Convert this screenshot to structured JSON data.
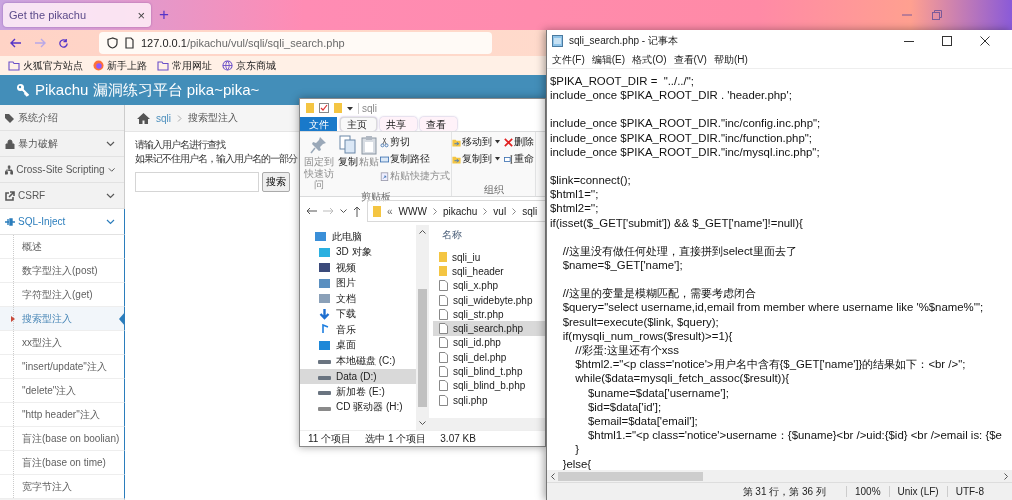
{
  "browser": {
    "tab": {
      "title": "Get the pikachu",
      "close": "×"
    },
    "new_tab": "+",
    "back": {
      "disabled": false
    },
    "forward": {
      "disabled": true
    },
    "url": {
      "host": "127.0.0.1",
      "path": "/pikachu/vul/sqli/sqli_search.php"
    },
    "bookmarks": [
      {
        "label": "火狐官方站点",
        "kind": "folder"
      },
      {
        "label": "新手上路",
        "kind": "firefox"
      },
      {
        "label": "常用网址",
        "kind": "folder"
      },
      {
        "label": "京东商城",
        "kind": "globe"
      }
    ]
  },
  "page": {
    "header": "Pikachu 漏洞练习平台 pika~pika~",
    "sidebar": [
      {
        "label": "系统介绍",
        "kind": "tag"
      },
      {
        "label": "暴力破解",
        "kind": "lock",
        "expanded": false
      },
      {
        "label": "Cross-Site Scripting",
        "kind": "sitemap",
        "expanded": false
      },
      {
        "label": "CSRF",
        "kind": "share",
        "expanded": false
      },
      {
        "label": "SQL-Inject",
        "kind": "plug",
        "expanded": true,
        "children": [
          {
            "label": "概述",
            "selected": false
          },
          {
            "label": "数字型注入(post)",
            "selected": false
          },
          {
            "label": "字符型注入(get)",
            "selected": false
          },
          {
            "label": "搜索型注入",
            "selected": true
          },
          {
            "label": "xx型注入",
            "selected": false
          },
          {
            "label": "\"insert/update\"注入",
            "selected": false
          },
          {
            "label": "\"delete\"注入",
            "selected": false
          },
          {
            "label": "\"http header\"注入",
            "selected": false
          },
          {
            "label": "盲注(base on boolian)",
            "selected": false
          },
          {
            "label": "盲注(base on time)",
            "selected": false
          },
          {
            "label": "宽字节注入",
            "selected": false
          }
        ]
      }
    ],
    "breadcrumb": {
      "link": "sqli",
      "current": "搜索型注入"
    },
    "prompt": [
      "请输入用户名进行查找",
      "如果记不住用户名，输入用户名的一部分"
    ],
    "search_button": "搜索"
  },
  "explorer": {
    "title": "sqli",
    "ribbon_tabs": [
      {
        "label": "文件",
        "kind": "file",
        "selected": false
      },
      {
        "label": "主页",
        "kind": "tab",
        "selected": true
      },
      {
        "label": "共享",
        "kind": "tab",
        "selected": false
      },
      {
        "label": "查看",
        "kind": "tab",
        "selected": false
      }
    ],
    "ribbon_groups": [
      {
        "label": "剪贴板",
        "large": [
          {
            "lines": [
              "固定到",
              "快速访问"
            ],
            "kind": "pin",
            "disabled": true
          },
          {
            "label": "复制",
            "kind": "copy",
            "disabled": false
          },
          {
            "label": "粘贴",
            "kind": "paste",
            "disabled": true
          }
        ],
        "columns": [
          [
            {
              "label": "剪切",
              "kind": "cut",
              "disabled": false
            },
            {
              "label": "复制路径",
              "kind": "copy-path",
              "disabled": false
            },
            {
              "label": "粘贴快捷方式",
              "kind": "paste-shortcut",
              "disabled": true
            }
          ]
        ]
      },
      {
        "label": "组织",
        "columns": [
          [
            {
              "label": "移动到",
              "kind": "move",
              "disabled": false,
              "dropdown": true
            },
            {
              "label": "复制到",
              "kind": "copy-to",
              "disabled": false,
              "dropdown": true
            }
          ],
          [
            {
              "label": "删除",
              "kind": "delete",
              "disabled": false
            },
            {
              "label": "重命",
              "kind": "rename",
              "disabled": false
            }
          ]
        ]
      }
    ],
    "address_prefix": "«",
    "address": [
      "WWW",
      "pikachu",
      "vul",
      "sqli"
    ],
    "nav_pane": [
      {
        "label": "此电脑",
        "kind": "pc",
        "selected": false
      },
      {
        "label": "3D 对象",
        "kind": "objects",
        "selected": false
      },
      {
        "label": "视频",
        "kind": "video",
        "selected": false
      },
      {
        "label": "图片",
        "kind": "pictures",
        "selected": false
      },
      {
        "label": "文档",
        "kind": "documents",
        "selected": false
      },
      {
        "label": "下载",
        "kind": "downloads",
        "selected": false
      },
      {
        "label": "音乐",
        "kind": "music",
        "selected": false
      },
      {
        "label": "桌面",
        "kind": "desktop",
        "selected": false
      },
      {
        "label": "本地磁盘 (C:)",
        "kind": "drive",
        "selected": false
      },
      {
        "label": "Data (D:)",
        "kind": "drive",
        "selected": true
      },
      {
        "label": "新加卷 (E:)",
        "kind": "drive",
        "selected": false
      },
      {
        "label": "CD 驱动器 (H:)",
        "kind": "cd",
        "selected": false
      }
    ],
    "column": "名称",
    "files": [
      {
        "name": "sqli_iu",
        "kind": "folder",
        "selected": false
      },
      {
        "name": "sqli_header",
        "kind": "folder",
        "selected": false
      },
      {
        "name": "sqli_x.php",
        "kind": "file",
        "selected": false
      },
      {
        "name": "sqli_widebyte.php",
        "kind": "file",
        "selected": false
      },
      {
        "name": "sqli_str.php",
        "kind": "file",
        "selected": false
      },
      {
        "name": "sqli_search.php",
        "kind": "file",
        "selected": true
      },
      {
        "name": "sqli_id.php",
        "kind": "file",
        "selected": false
      },
      {
        "name": "sqli_del.php",
        "kind": "file",
        "selected": false
      },
      {
        "name": "sqli_blind_t.php",
        "kind": "file",
        "selected": false
      },
      {
        "name": "sqli_blind_b.php",
        "kind": "file",
        "selected": false
      },
      {
        "name": "sqli.php",
        "kind": "file",
        "selected": false
      }
    ],
    "status": [
      "11 个项目",
      "选中 1 个项目",
      "3.07 KB"
    ]
  },
  "notepad": {
    "title": "sqli_search.php - 记事本",
    "menu": [
      "文件(F)",
      "编辑(E)",
      "格式(O)",
      "查看(V)",
      "帮助(H)"
    ],
    "code_blocks": [
      [
        "$PIKA_ROOT_DIR =  \"../../\";",
        "include_once $PIKA_ROOT_DIR . 'header.php';"
      ],
      [
        "include_once $PIKA_ROOT_DIR.\"inc/config.inc.php\";",
        "include_once $PIKA_ROOT_DIR.\"inc/function.php\";",
        "include_once $PIKA_ROOT_DIR.\"inc/mysql.inc.php\";"
      ],
      [
        "$link=connect();",
        "$html1='';",
        "$html2='';",
        "if(isset($_GET['submit']) && $_GET['name']!=null){"
      ],
      [
        "    //这里没有做任何处理，直接拼到select里面去了",
        "    $name=$_GET['name'];"
      ],
      [
        "    //这里的变量是模糊匹配，需要考虑闭合",
        "    $query=\"select username,id,email from member where username like '%$name%'\";",
        "    $result=execute($link, $query);",
        "    if(mysqli_num_rows($result)>=1){",
        "        //彩蛋:这里还有个xss",
        "        $html2.=\"<p class='notice'>用户名中含有{$_GET['name']}的结果如下：<br />\";",
        "        while($data=mysqli_fetch_assoc($result)){",
        "            $uname=$data['username'];",
        "            $id=$data['id'];",
        "            $email=$data['email'];",
        "            $html1.=\"<p class='notice'>username：{$uname}<br />uid:{$id} <br />email is: {$e",
        "        }",
        "    }else{"
      ]
    ],
    "status": [
      "第 31 行，第 36 列",
      "100%",
      "Unix (LF)",
      "UTF-8"
    ]
  }
}
